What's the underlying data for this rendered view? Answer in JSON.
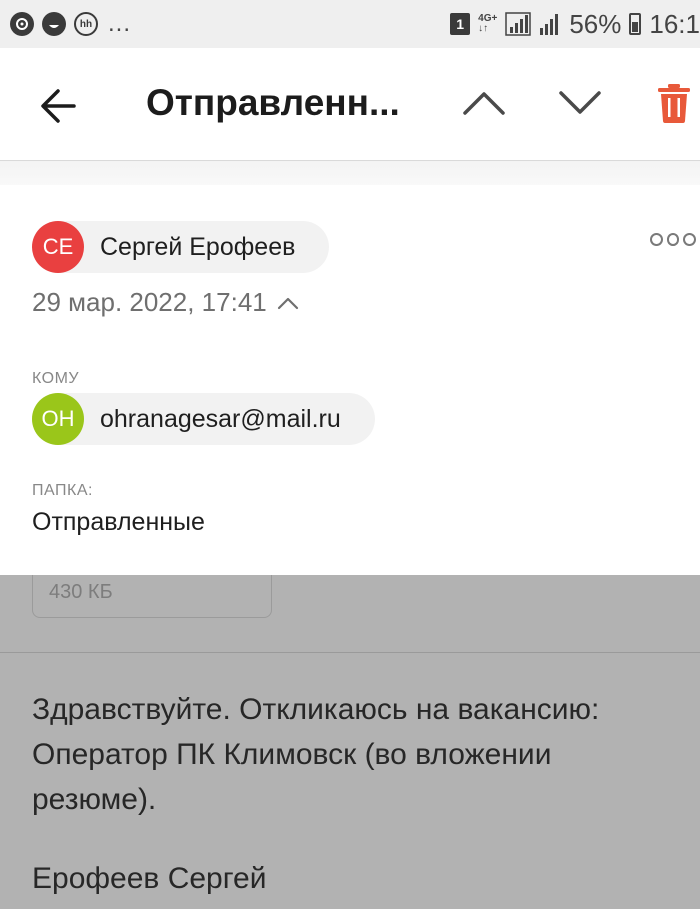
{
  "status_bar": {
    "hh_icon_label": "hh",
    "overflow": "...",
    "sim_number": "1",
    "network_type": "4G+",
    "battery_percent": "56%",
    "time": "16:1"
  },
  "header": {
    "title": "Отправленн..."
  },
  "message": {
    "sender": {
      "initials": "СЕ",
      "name": "Сергей Ерофеев",
      "avatar_color": "#e94040"
    },
    "date": "29 мар. 2022, 17:41",
    "to_label": "КОМУ",
    "recipient": {
      "initials": "OH",
      "email": "ohranagesar@mail.ru",
      "avatar_color": "#9ac61a"
    },
    "folder_label": "ПАПКА:",
    "folder_value": "Отправленные",
    "attachment_size": "430 КБ",
    "body_text": "Здравствуйте. Откликаюсь на вакансию: Оператор ПК Климовск (во вложении резюме).",
    "signature": "Ерофеев Сергей"
  },
  "colors": {
    "accent_delete": "#e8593a",
    "dim_overlay": "#b2b2b2"
  },
  "icons": {
    "back": "arrow-left-icon",
    "prev": "chevron-up-icon",
    "next": "chevron-down-icon",
    "delete": "trash-icon",
    "more": "more-horizontal-icon",
    "collapse": "caret-up-icon"
  }
}
